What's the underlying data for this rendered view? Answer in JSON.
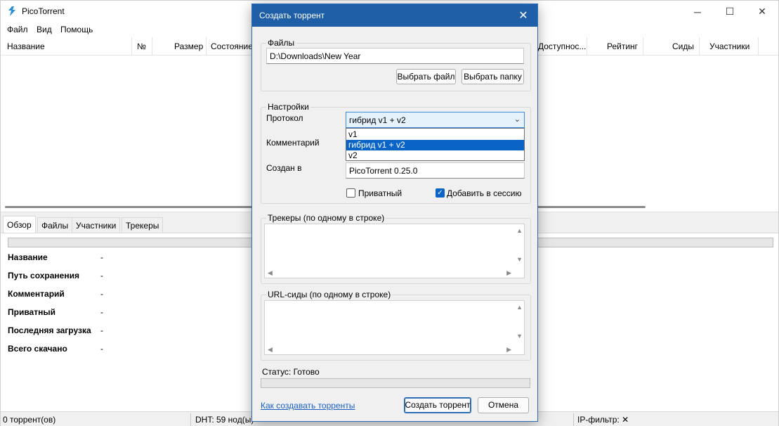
{
  "app": {
    "title": "PicoTorrent",
    "minimize_glyph": "─",
    "maximize_glyph": "☐",
    "close_glyph": "✕"
  },
  "menu": [
    "Файл",
    "Вид",
    "Помощь"
  ],
  "columns": [
    "Название",
    "№",
    "Размер",
    "Состояние",
    "Доступнос...",
    "Рейтинг",
    "Сиды",
    "Участники"
  ],
  "tabs": [
    "Обзор",
    "Файлы",
    "Участники",
    "Трекеры"
  ],
  "overview": {
    "rows": [
      {
        "label": "Название",
        "value": "-"
      },
      {
        "label": "Путь сохранения",
        "value": "-"
      },
      {
        "label": "Комментарий",
        "value": "-"
      },
      {
        "label": "Приватный",
        "value": "-"
      },
      {
        "label": "Последняя загрузка",
        "value": "-"
      },
      {
        "label": "Всего скачано",
        "value": "-"
      }
    ]
  },
  "statusbar": {
    "torrents": "0 торрент(ов)",
    "dht": "DHT: 59 нод(ы)",
    "ipfilter": "IP-фильтр: ✕"
  },
  "dialog": {
    "title": "Создать торрент",
    "close_glyph": "✕",
    "files_group": "Файлы",
    "path_value": "D:\\Downloads\\New Year",
    "select_file": "Выбрать файл",
    "select_folder": "Выбрать папку",
    "settings_group": "Настройки",
    "protocol_label": "Протокол",
    "protocol_value": "гибрид v1 + v2",
    "protocol_options": [
      "v1",
      "гибрид v1 + v2",
      "v2"
    ],
    "comment_label": "Комментарий",
    "created_by_label": "Создан в",
    "created_by_value": "PicoTorrent 0.25.0",
    "private_label": "Приватный",
    "private_checked": false,
    "add_to_session_label": "Добавить в сессию",
    "add_to_session_checked": true,
    "trackers_group": "Трекеры (по одному в строке)",
    "urlseeds_group": "URL-сиды (по одному в строке)",
    "status_text": "Статус: Готово",
    "help_link": "Как создавать торренты",
    "create_button": "Создать торрент",
    "cancel_button": "Отмена"
  },
  "colors": {
    "dialog_titlebar": "#1f5fa8",
    "accent": "#0a64c8",
    "link": "#1a5fc8"
  }
}
